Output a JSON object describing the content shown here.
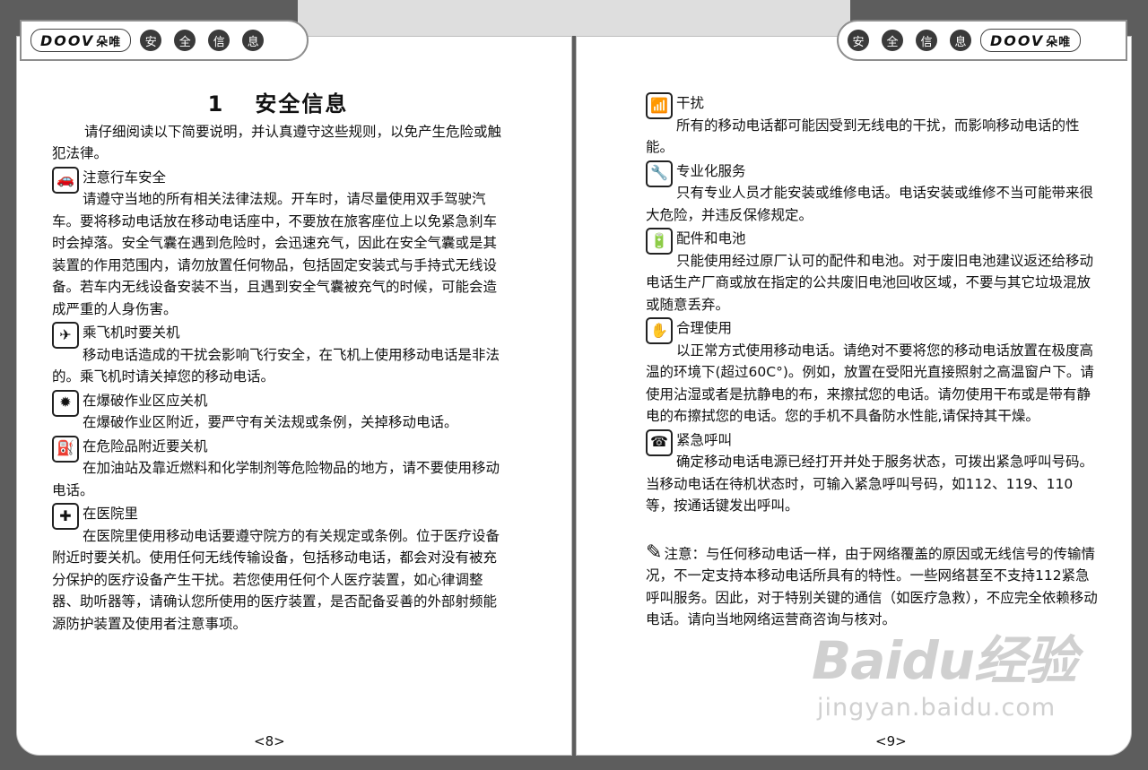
{
  "header": {
    "logo_brand": "DOOV",
    "logo_cn": "朵唯",
    "chapter_chars": [
      "安",
      "全",
      "信",
      "息"
    ]
  },
  "left": {
    "title_num": "1",
    "title_text": "安全信息",
    "intro": "请仔细阅读以下简要说明，并认真遵守这些规则，以免产生危险或触犯法律。",
    "sections": [
      {
        "heading": "注意行车安全",
        "body": "请遵守当地的所有相关法律法规。开车时，请尽量使用双手驾驶汽车。要将移动电话放在移动电话座中，不要放在旅客座位上以免紧急刹车时会掉落。安全气囊在遇到危险时，会迅速充气，因此在安全气囊或是其装置的作用范围内，请勿放置任何物品，包括固定安装式与手持式无线设备。若车内无线设备安装不当，且遇到安全气囊被充气的时候，可能会造成严重的人身伤害。",
        "icon": "car-icon"
      },
      {
        "heading": "乘飞机时要关机",
        "body": "移动电话造成的干扰会影响飞行安全，在飞机上使用移动电话是非法的。乘飞机时请关掉您的移动电话。",
        "icon": "airplane-icon"
      },
      {
        "heading": "在爆破作业区应关机",
        "body": "在爆破作业区附近，要严守有关法规或条例，关掉移动电话。",
        "icon": "blasting-icon"
      },
      {
        "heading": "在危险品附近要关机",
        "body": "在加油站及靠近燃料和化学制剂等危险物品的地方，请不要使用移动电话。",
        "icon": "fuel-pump-icon"
      },
      {
        "heading": "在医院里",
        "body": "在医院里使用移动电话要遵守院方的有关规定或条例。位于医疗设备附近时要关机。使用任何无线传输设备，包括移动电话，都会对没有被充分保护的医疗设备产生干扰。若您使用任何个人医疗装置，如心律调整器、助听器等，请确认您所使用的医疗装置，是否配备妥善的外部射频能源防护装置及使用者注意事项。",
        "icon": "hospital-cross-icon"
      }
    ],
    "page_number": "<8>"
  },
  "right": {
    "sections": [
      {
        "heading": "干扰",
        "body": "所有的移动电话都可能因受到无线电的干扰，而影响移动电话的性能。",
        "icon": "interference-icon"
      },
      {
        "heading": "专业化服务",
        "body": "只有专业人员才能安装或维修电话。电话安装或维修不当可能带来很大危险，并违反保修规定。",
        "icon": "service-icon"
      },
      {
        "heading": "配件和电池",
        "body": "只能使用经过原厂认可的配件和电池。对于废旧电池建议返还给移动电话生产厂商或放在指定的公共废旧电池回收区域，不要与其它垃圾混放或随意丢弃。",
        "icon": "battery-icon"
      },
      {
        "heading": "合理使用",
        "body": "以正常方式使用移动电话。请绝对不要将您的移动电话放置在极度高温的环境下(超过60C°)。例如，放置在受阳光直接照射之高温窗户下。请使用沾湿或者是抗静电的布，来擦拭您的电话。请勿使用干布或是带有静电的布擦拭您的电话。您的手机不具备防水性能,请保持其干燥。",
        "icon": "proper-use-icon"
      },
      {
        "heading": "紧急呼叫",
        "body": "确定移动电话电源已经打开并处于服务状态，可拨出紧急呼叫号码。当移动电话在待机状态时，可输入紧急呼叫号码，如112、119、110等，按通话键发出呼叫。",
        "icon": "emergency-call-icon"
      }
    ],
    "note": "注意：与任何移动电话一样，由于网络覆盖的原因或无线信号的传输情况，不一定支持本移动电话所具有的特性。一些网络甚至不支持112紧急呼叫服务。因此，对于特别关键的通信（如医疗急救），不应完全依赖移动电话。请向当地网络运营商咨询与核对。",
    "page_number": "<9>"
  },
  "watermark": {
    "big": "Baidu经验",
    "small": "jingyan.baidu.com"
  }
}
